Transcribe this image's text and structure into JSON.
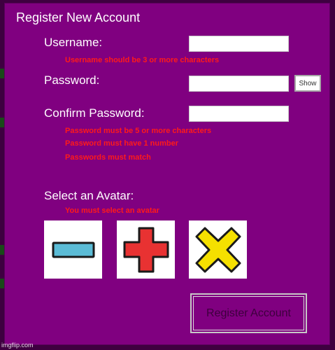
{
  "window": {
    "title": "Register New Account"
  },
  "form": {
    "username_label": "Username:",
    "username_value": "",
    "username_error": "Username should be 3 or more characters",
    "password_label": "Password:",
    "password_value": "",
    "show_label": "Show",
    "confirm_label": "Confirm Password:",
    "confirm_value": "",
    "password_errors": [
      "Password must be 5 or more characters",
      "Password must have 1 number",
      "Passwords must match"
    ],
    "avatar_label": "Select an Avatar:",
    "avatar_error": "You must select an avatar",
    "avatars": [
      {
        "icon": "minus-icon",
        "color": "#5bbcd6"
      },
      {
        "icon": "plus-icon",
        "color": "#e83232"
      },
      {
        "icon": "x-icon",
        "color": "#f5e000"
      }
    ],
    "register_label": "Register Account"
  },
  "colors": {
    "background": "#800080",
    "error": "#ff1a1a"
  },
  "watermark": "imgflip.com"
}
